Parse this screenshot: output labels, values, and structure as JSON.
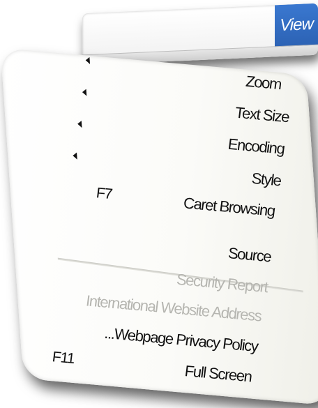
{
  "menubar": {
    "view_label": "View"
  },
  "menu": {
    "items": [
      {
        "label": "Zoom",
        "has_submenu": true,
        "enabled": true
      },
      {
        "label": "Text Size",
        "has_submenu": true,
        "enabled": true
      },
      {
        "label": "Encoding",
        "has_submenu": true,
        "enabled": true
      },
      {
        "label": "Style",
        "has_submenu": true,
        "enabled": true
      },
      {
        "label": "Caret Browsing",
        "shortcut": "F7",
        "enabled": true
      },
      {
        "label": "Source",
        "enabled": true
      },
      {
        "label": "Security Report",
        "enabled": false
      },
      {
        "label": "International Website Address",
        "enabled": false
      },
      {
        "label": "...Webpage Privacy Policy",
        "enabled": true
      },
      {
        "label": "Full Screen",
        "shortcut": "F11",
        "enabled": true
      }
    ]
  },
  "colors": {
    "view_button": "#2c62b4",
    "disabled_text": "#b5b5b0",
    "text": "#111111"
  },
  "icons": {
    "submenu_arrow": "left-pointing-triangle"
  }
}
